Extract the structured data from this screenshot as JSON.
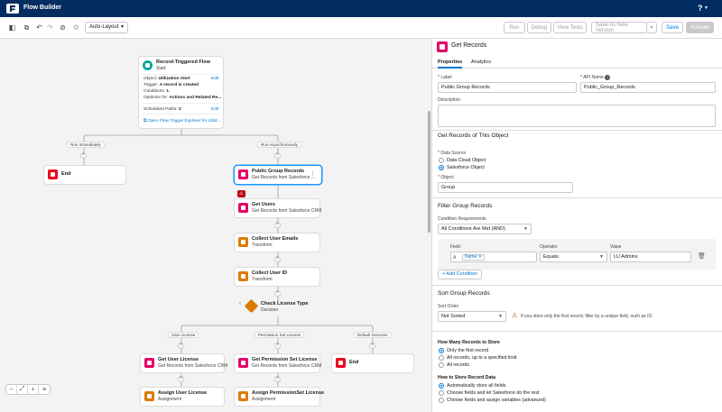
{
  "topbar": {
    "title": "Flow Builder",
    "help": "?"
  },
  "toolbar": {
    "layout_select": "Auto-Layout",
    "run": "Run",
    "debug": "Debug",
    "view_tests": "View Tests",
    "save_as": "Save As New Version",
    "save": "Save",
    "activate": "Activate"
  },
  "canvas": {
    "start": {
      "title": "Record-Triggered Flow",
      "subtitle": "Start",
      "object_label": "Object:",
      "object_value": "Utilization Alert",
      "trigger_label": "Trigger:",
      "trigger_value": "A record is created",
      "conditions_label": "Conditions:",
      "conditions_value": "1",
      "optimize_label": "Optimize for:",
      "optimize_value": "Actions and Related Re...",
      "scheduled_label": "Scheduled Paths:",
      "scheduled_value": "2",
      "edit": "Edit",
      "explorer_link": "Open Flow Trigger Explorer for Utiliz..."
    },
    "paths": {
      "run_immediately": "Run Immediately",
      "run_async": "Run Asynchronously"
    },
    "end_label": "End",
    "nodes": [
      {
        "title": "Public Group Records",
        "subtitle": "Get Records from Salesforce ..."
      },
      {
        "title": "Get Users",
        "subtitle": "Get Records from Salesforce CRM"
      },
      {
        "title": "Collect User Emails",
        "subtitle": "Transform"
      },
      {
        "title": "Collect User ID",
        "subtitle": "Transform"
      },
      {
        "title": "Check License Type",
        "subtitle": "Decision"
      }
    ],
    "outcomes": [
      "User License",
      "Permission Set License",
      "Default Outcome"
    ],
    "bottom_nodes": [
      {
        "title": "Get User License",
        "subtitle": "Get Records from Salesforce CRM"
      },
      {
        "title": "Get Permission Set License",
        "subtitle": "Get Records from Salesforce CRM"
      },
      {
        "title": "Assign User License",
        "subtitle": "Assignment"
      },
      {
        "title": "Assign PermissionSet License",
        "subtitle": "Assignment"
      }
    ]
  },
  "panel": {
    "title": "Get Records",
    "tabs": [
      "Properties",
      "Analytics"
    ],
    "label_field": {
      "label": "Label",
      "value": "Public Group Records"
    },
    "api_field": {
      "label": "API Name",
      "value": "Public_Group_Records"
    },
    "description_label": "Description",
    "section_object": "Get Records of This Object",
    "data_source_label": "Data Source",
    "data_source_options": [
      "Data Cloud Object",
      "Salesforce Object"
    ],
    "object_field": {
      "label": "Object",
      "value": "Group"
    },
    "section_filter": "Filter Group Records",
    "condition_req_label": "Condition Requirements",
    "condition_req_value": "All Conditions Are Met (AND)",
    "filter_headers": {
      "field": "Field",
      "operator": "Operator",
      "value": "Value"
    },
    "filter_row": {
      "field": "Name",
      "operator": "Equals",
      "value": "LU Admins"
    },
    "add_condition": "+ Add Condition",
    "section_sort": "Sort Group Records",
    "sort_order_label": "Sort Order",
    "sort_order_value": "Not Sorted",
    "sort_warning": "If you store only the first record, filter by a unique field, such as ID.",
    "how_many_label": "How Many Records to Store",
    "how_many_options": [
      "Only the first record",
      "All records, up to a specified limit",
      "All records"
    ],
    "how_store_label": "How to Store Record Data",
    "how_store_options": [
      "Automatically store all fields",
      "Choose fields and let Salesforce do the rest",
      "Choose fields and assign variables (advanced)"
    ]
  }
}
